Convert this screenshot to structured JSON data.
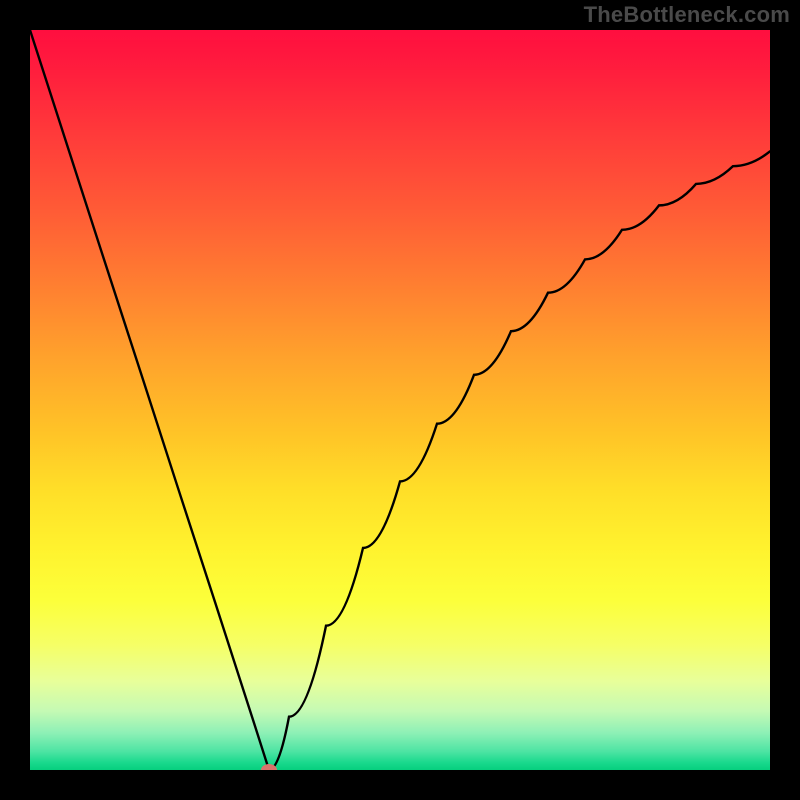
{
  "attribution": "TheBottleneck.com",
  "chart_data": {
    "type": "line",
    "title": "",
    "xlabel": "",
    "ylabel": "",
    "xlim": [
      0,
      1
    ],
    "ylim": [
      0,
      1
    ],
    "series": [
      {
        "name": "bottleneck-curve",
        "x": [
          0.0,
          0.05,
          0.1,
          0.15,
          0.2,
          0.25,
          0.3,
          0.323,
          0.35,
          0.4,
          0.45,
          0.5,
          0.55,
          0.6,
          0.65,
          0.7,
          0.75,
          0.8,
          0.85,
          0.9,
          0.95,
          1.0
        ],
        "y": [
          1.0,
          0.845,
          0.69,
          0.536,
          0.381,
          0.227,
          0.072,
          0.0,
          0.072,
          0.195,
          0.3,
          0.39,
          0.468,
          0.534,
          0.593,
          0.645,
          0.69,
          0.73,
          0.763,
          0.792,
          0.816,
          0.836
        ]
      }
    ],
    "marker": {
      "x": 0.323,
      "y": 0.0,
      "color": "#d8736b"
    },
    "gradient_stops": [
      {
        "pos": 0.0,
        "color": "#ff0e3f"
      },
      {
        "pos": 0.5,
        "color": "#ffb82a"
      },
      {
        "pos": 0.78,
        "color": "#fcff3a"
      },
      {
        "pos": 1.0,
        "color": "#06cf7e"
      }
    ]
  }
}
